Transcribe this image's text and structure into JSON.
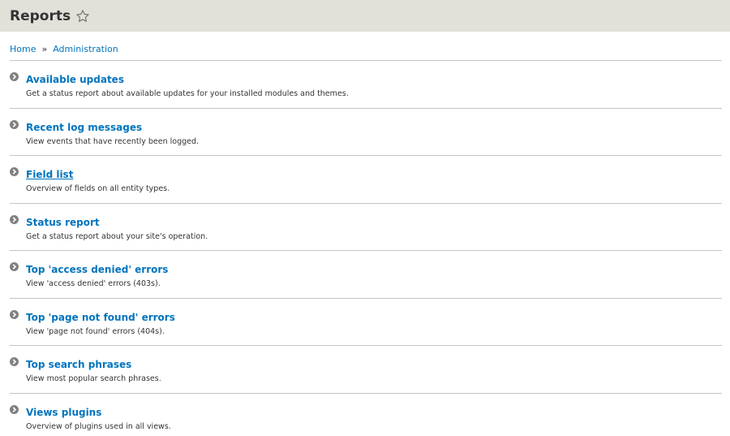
{
  "header": {
    "title": "Reports",
    "star_icon": "star-outline-icon"
  },
  "breadcrumb": {
    "items": [
      {
        "label": "Home"
      },
      {
        "label": "Administration"
      }
    ],
    "separator": "»"
  },
  "colors": {
    "header_bg": "#e1e0d9",
    "link": "#0074bd",
    "text": "#333333",
    "divider": "#c4c4c4",
    "arrow_icon": "#808080"
  },
  "reports": [
    {
      "title": "Available updates",
      "description": "Get a status report about available updates for your installed modules and themes."
    },
    {
      "title": "Recent log messages",
      "description": "View events that have recently been logged."
    },
    {
      "title": "Field list",
      "description": "Overview of fields on all entity types."
    },
    {
      "title": "Status report",
      "description": "Get a status report about your site's operation."
    },
    {
      "title": "Top 'access denied' errors",
      "description": "View 'access denied' errors (403s)."
    },
    {
      "title": "Top 'page not found' errors",
      "description": "View 'page not found' errors (404s)."
    },
    {
      "title": "Top search phrases",
      "description": "View most popular search phrases."
    },
    {
      "title": "Views plugins",
      "description": "Overview of plugins used in all views."
    }
  ]
}
